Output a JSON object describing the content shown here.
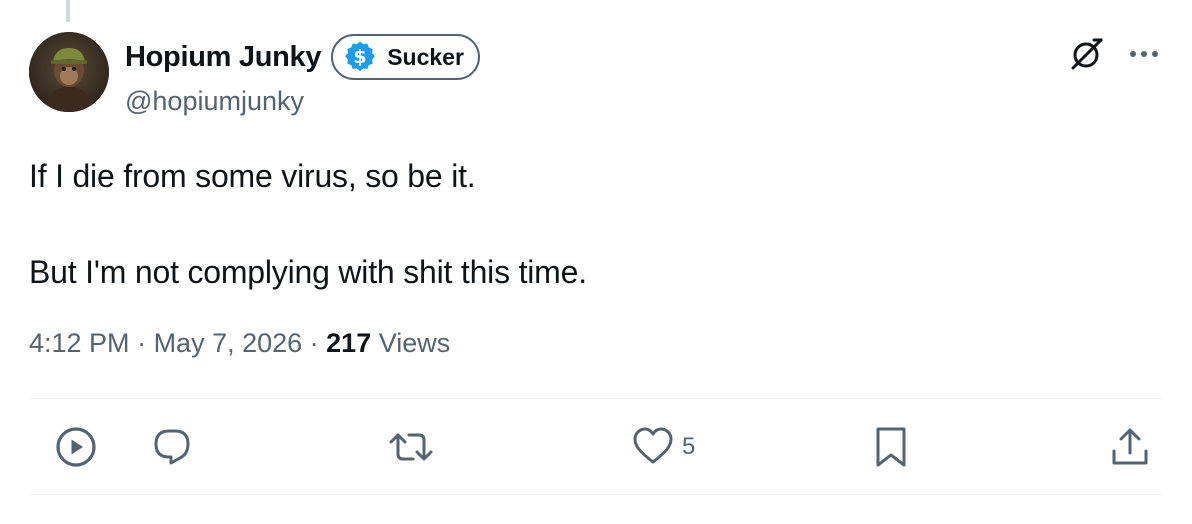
{
  "author": {
    "display_name": "Hopium Junky",
    "badge_label": "Sucker",
    "handle": "@hopiumjunky"
  },
  "header_icons": {
    "grok": "grok-icon",
    "more": "more-horizontal-icon"
  },
  "tweet": {
    "lines": [
      "If I die from some virus, so be it.",
      "But I'm not complying with shit this time."
    ]
  },
  "meta": {
    "time": "4:12 PM",
    "separator": " · ",
    "date": "May 7, 2026",
    "views_count": "217",
    "views_label": "Views"
  },
  "actions": {
    "play_icon": "play-circle-icon",
    "reply_icon": "reply-icon",
    "retweet_icon": "retweet-icon",
    "like_icon": "heart-icon",
    "like_count": "5",
    "bookmark_icon": "bookmark-icon",
    "share_icon": "share-icon"
  },
  "colors": {
    "text_primary": "#0f1419",
    "text_secondary": "#536471",
    "badge_blue": "#1d9bf0",
    "divider": "#eff3f4"
  }
}
